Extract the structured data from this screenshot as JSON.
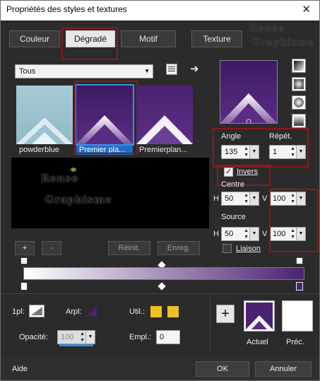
{
  "window": {
    "title": "Propriétés des styles et textures",
    "close_glyph": "✕"
  },
  "tabs": [
    {
      "label": "Couleur"
    },
    {
      "label": "Dégradé"
    },
    {
      "label": "Motif"
    },
    {
      "label": "Texture"
    }
  ],
  "watermark": {
    "line1": "Renee",
    "line2": "Graphisme"
  },
  "category_select": {
    "value": "Tous"
  },
  "gradients": [
    {
      "caption": "powderblue",
      "selected": false
    },
    {
      "caption": "Premier pla...",
      "selected": true
    },
    {
      "caption": "Premierplan...",
      "selected": false
    }
  ],
  "gradient_buttons": {
    "add": "+",
    "remove": "-",
    "reset": "Réinit.",
    "save": "Enreg."
  },
  "params": {
    "angle_label": "Angle",
    "angle_value": "135",
    "repeat_label": "Répét.",
    "repeat_value": "1",
    "invert_label": "Invers",
    "invert_checked": true,
    "center_label": "Centre",
    "center_h": "50",
    "center_v": "100",
    "source_label": "Source",
    "source_h": "50",
    "source_v": "100",
    "h_label": "H",
    "v_label": "V",
    "link_label": "Liaison",
    "link_checked": false
  },
  "bottom": {
    "pl_label": "1pl:",
    "arpl_label": "Arpl:",
    "util_label": "Util.:",
    "opacity_label": "Opacité:",
    "opacity_value": "100",
    "empl_label": "Empl.:",
    "empl_value": "0",
    "current_label": "Actuel",
    "previous_label": "Préc.",
    "add_glyph": "+"
  },
  "footer": {
    "help": "Aide",
    "ok": "OK",
    "cancel": "Annuler"
  },
  "colors": {
    "purple": "#4b2272",
    "light_blue": "#9cc3cf",
    "accent_blue": "#2d8ae0",
    "yellow": "#f0c020",
    "red_box": "#8b1a1a"
  }
}
